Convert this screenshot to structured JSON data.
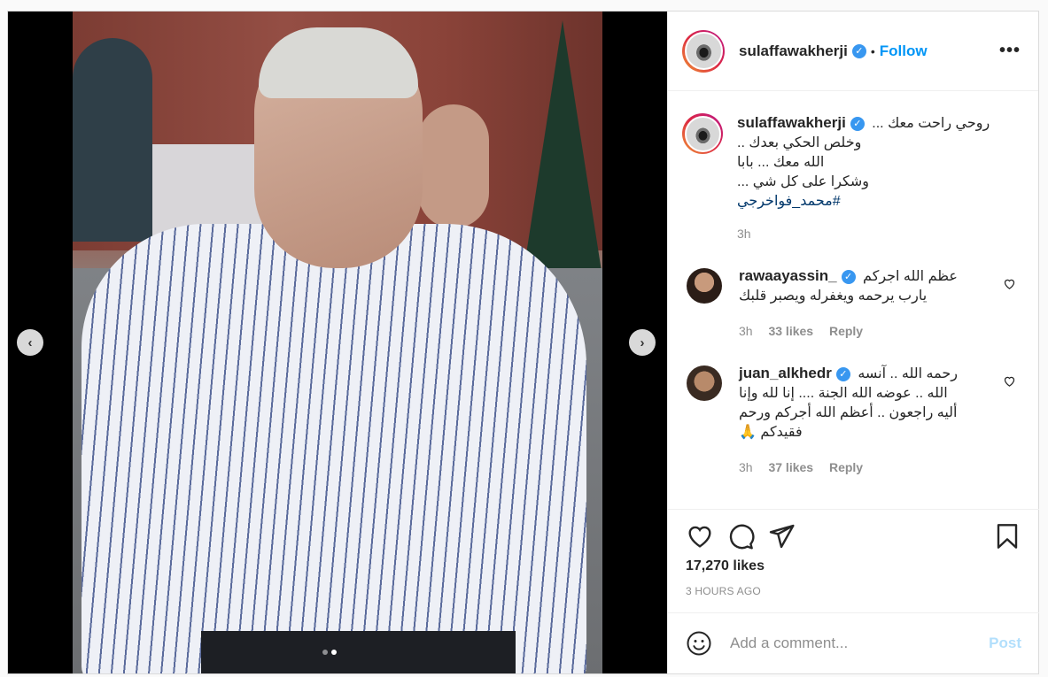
{
  "post": {
    "username": "sulaffawakherji",
    "separator": "•",
    "follow_label": "Follow",
    "more_label": "•••",
    "media_dots": 2,
    "active_dot": 2
  },
  "caption": {
    "username": "sulaffawakherji",
    "lines": [
      "روحي راحت معك ...",
      "وخلص الحكي بعدك ..",
      "الله معك ... بابا",
      "وشكرا على كل شي ...",
      "#محمد_فواخرجي"
    ],
    "time": "3h"
  },
  "comments": [
    {
      "username": "rawaayassin_",
      "text_lines": [
        "عظم الله اجركم",
        "يارب يرحمه ويغفرله ويصبر قلبك"
      ],
      "time": "3h",
      "likes": "33 likes",
      "reply": "Reply"
    },
    {
      "username": "juan_alkhedr",
      "text_lines": [
        "رحمه الله .. آنسه",
        "الله .. عوضه الله الجنة .... إنا لله وإنا",
        "أليه راجعون .. أعظم الله أجركم ورحم",
        "فقيدكم 🙏"
      ],
      "time": "3h",
      "likes": "37 likes",
      "reply": "Reply"
    }
  ],
  "stats": {
    "likes": "17,270 likes",
    "time_ago": "3 HOURS AGO"
  },
  "add_comment": {
    "placeholder": "Add a comment...",
    "post_label": "Post"
  },
  "colors": {
    "accent": "#0095f6",
    "verified": "#3897f0",
    "post_disabled": "#b2dffc"
  }
}
